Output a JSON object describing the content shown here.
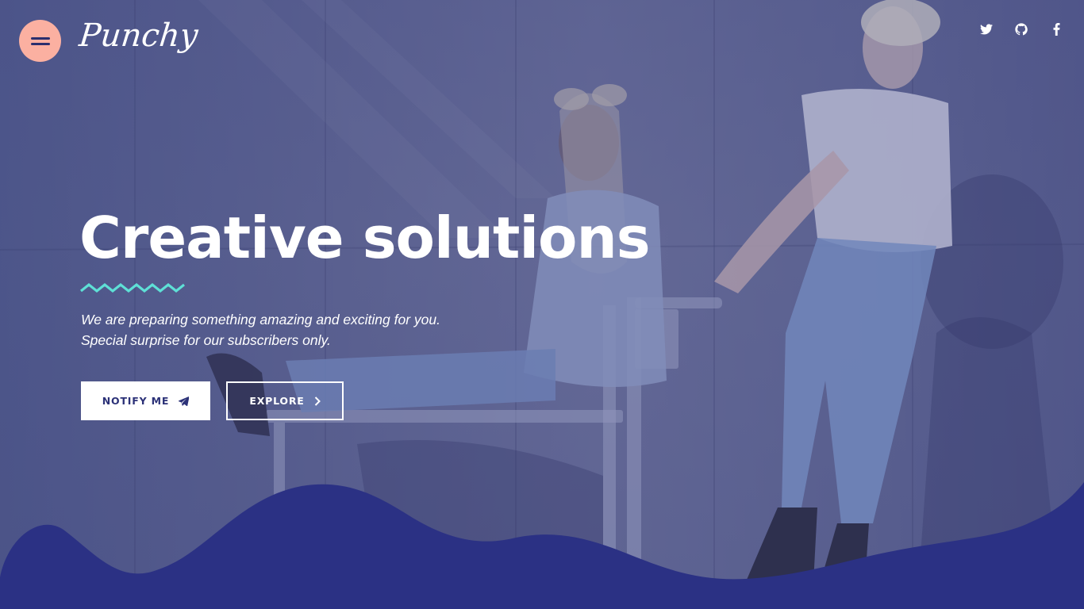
{
  "brand": {
    "logo_text": "Punchy"
  },
  "header": {
    "menu_icon": "hamburger-menu-icon",
    "socials": [
      {
        "name": "twitter",
        "icon": "twitter-icon"
      },
      {
        "name": "github",
        "icon": "github-icon"
      },
      {
        "name": "facebook",
        "icon": "facebook-icon"
      }
    ]
  },
  "hero": {
    "title": "Creative solutions",
    "subtitle_line1": "We are preparing something amazing and exciting for you.",
    "subtitle_line2": "Special surprise for our subscribers only.",
    "notify_label": "NOTIFY ME",
    "notify_icon": "paper-plane-icon",
    "explore_label": "EXPLORE",
    "explore_icon": "chevron-right-icon"
  },
  "colors": {
    "menu_button": "#fbb0a1",
    "accent_zigzag": "#5ee0d6",
    "wave": "#2b3184",
    "button_text": "#2c3278",
    "overlay": "#404682"
  }
}
